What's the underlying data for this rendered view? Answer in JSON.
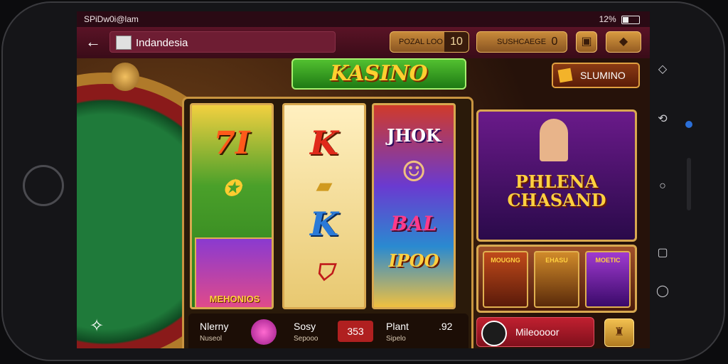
{
  "status_bar": {
    "left": "SPiDw0i@lam",
    "right": "12%"
  },
  "header": {
    "back_icon": "arrow-left-icon",
    "search_value": "Indandesia",
    "balance_label": "POZAL LOO",
    "balance_value": "10",
    "coins_label": "SUSHCAEGE",
    "coins_value": "0"
  },
  "game": {
    "logo": "KASINO",
    "shop_button": "SLUMINO",
    "reels": [
      {
        "top": "7I",
        "mid": "",
        "bottom_label": "MEHONIOS"
      },
      {
        "top": "K",
        "mid": "",
        "bottom": "K"
      },
      {
        "top": "JHOK",
        "mid": "BAL",
        "bottom": "IPOO"
      }
    ],
    "bottom_bar": {
      "item1_title": "Nlerny",
      "item1_sub": "Nuseol",
      "item2_title": "Sosy",
      "item2_sub": "Sepooo",
      "item3_value": "353",
      "item4_title": "Plant",
      "item4_sub": "Sipelo",
      "item5_value": ".92"
    },
    "promo_title": "PHLENA CHASAND",
    "mini_titles": [
      "MOUGNG",
      "EHASU",
      "MOETIC"
    ],
    "player_name": "Mileoooor"
  }
}
